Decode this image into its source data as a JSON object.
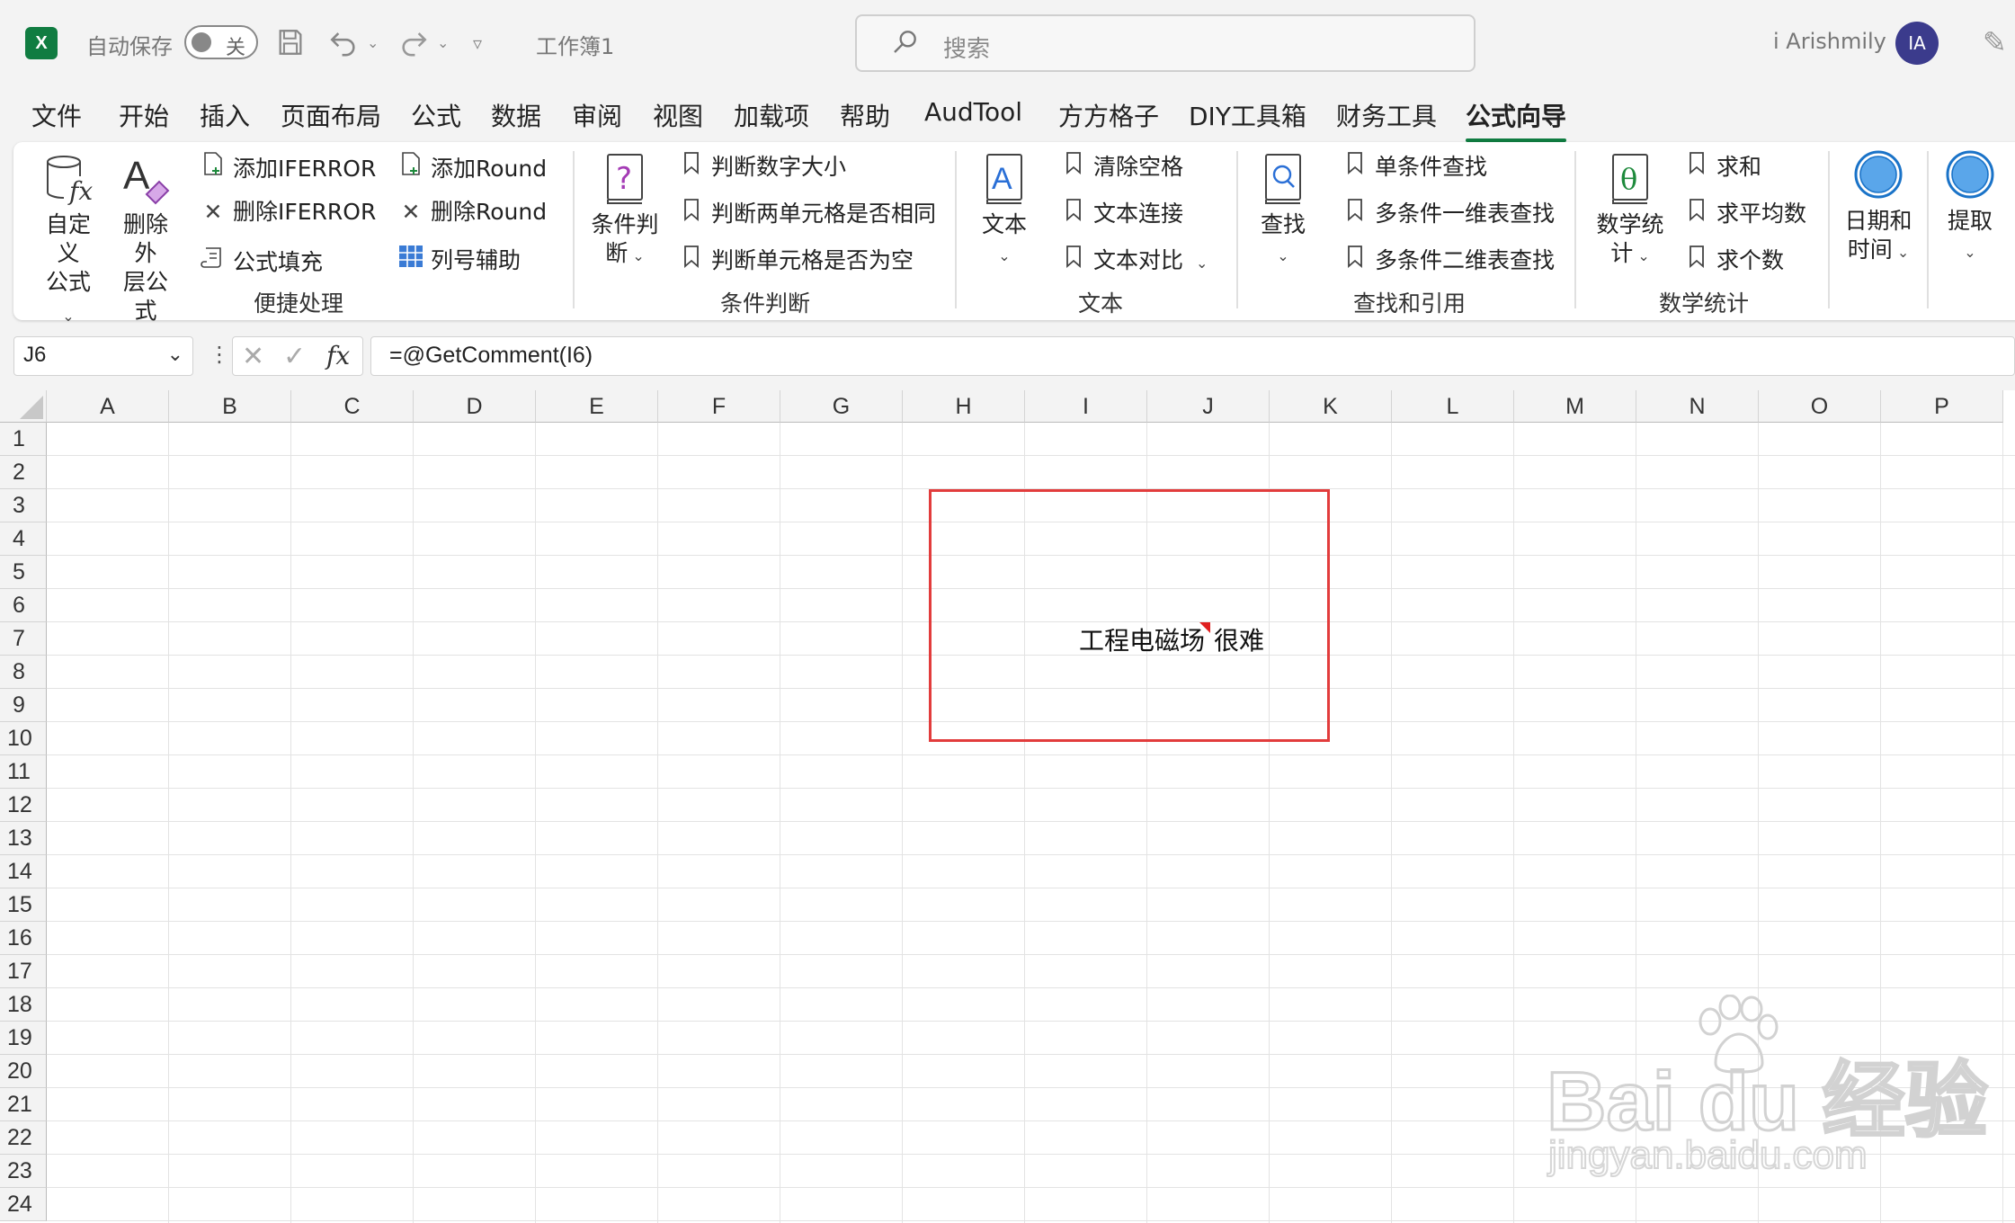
{
  "titlebar": {
    "autosave_label": "自动保存",
    "autosave_state": "关",
    "workbook": "工作簿1",
    "search_placeholder": "搜索",
    "user_name": "i Arishmily",
    "avatar_initials": "IA"
  },
  "menu": {
    "tabs": [
      "文件",
      "开始",
      "插入",
      "页面布局",
      "公式",
      "数据",
      "审阅",
      "视图",
      "加载项",
      "帮助",
      "AudTool",
      "方方格子",
      "DIY工具箱",
      "财务工具",
      "公式向导"
    ],
    "active": "公式向导"
  },
  "ribbon": {
    "quick": {
      "group": "便捷处理",
      "custom_formula": [
        "自定义",
        "公式"
      ],
      "remove_outer": [
        "删除外",
        "层公式"
      ],
      "add_iferror": "添加IFERROR",
      "del_iferror": "删除IFERROR",
      "fill_formula": "公式填充",
      "add_round": "添加Round",
      "del_round": "删除Round",
      "col_helper": "列号辅助"
    },
    "condition": {
      "group": "条件判断",
      "big": [
        "条件判",
        "断"
      ],
      "items": [
        "判断数字大小",
        "判断两单元格是否相同",
        "判断单元格是否为空"
      ]
    },
    "text": {
      "group": "文本",
      "big": "文本",
      "items": [
        "清除空格",
        "文本连接",
        "文本对比"
      ]
    },
    "lookup": {
      "group": "查找和引用",
      "big": "查找",
      "items": [
        "单条件查找",
        "多条件一维表查找",
        "多条件二维表查找"
      ]
    },
    "math": {
      "group": "数学统计",
      "big": [
        "数学统",
        "计"
      ],
      "items": [
        "求和",
        "求平均数",
        "求个数"
      ]
    },
    "datetime": [
      "日期和",
      "时间"
    ],
    "extract": "提取"
  },
  "formula_bar": {
    "name_box": "J6",
    "fx": "fx",
    "formula": "=@GetComment(I6)"
  },
  "grid": {
    "columns": [
      "A",
      "B",
      "C",
      "D",
      "E",
      "F",
      "G",
      "H",
      "I",
      "J",
      "K",
      "L",
      "M",
      "N",
      "O",
      "P"
    ],
    "rows": [
      "1",
      "2",
      "3",
      "4",
      "5",
      "6",
      "7",
      "8",
      "9",
      "10",
      "11",
      "12",
      "13",
      "14",
      "15",
      "16",
      "17",
      "18",
      "19",
      "20",
      "21",
      "22",
      "23",
      "24"
    ],
    "cell_i6": "工程电磁场",
    "cell_j6": "很难"
  },
  "colors": {
    "accent": "#107c41",
    "highlight": "#e23c3c",
    "comment_indicator": "#e02020"
  }
}
